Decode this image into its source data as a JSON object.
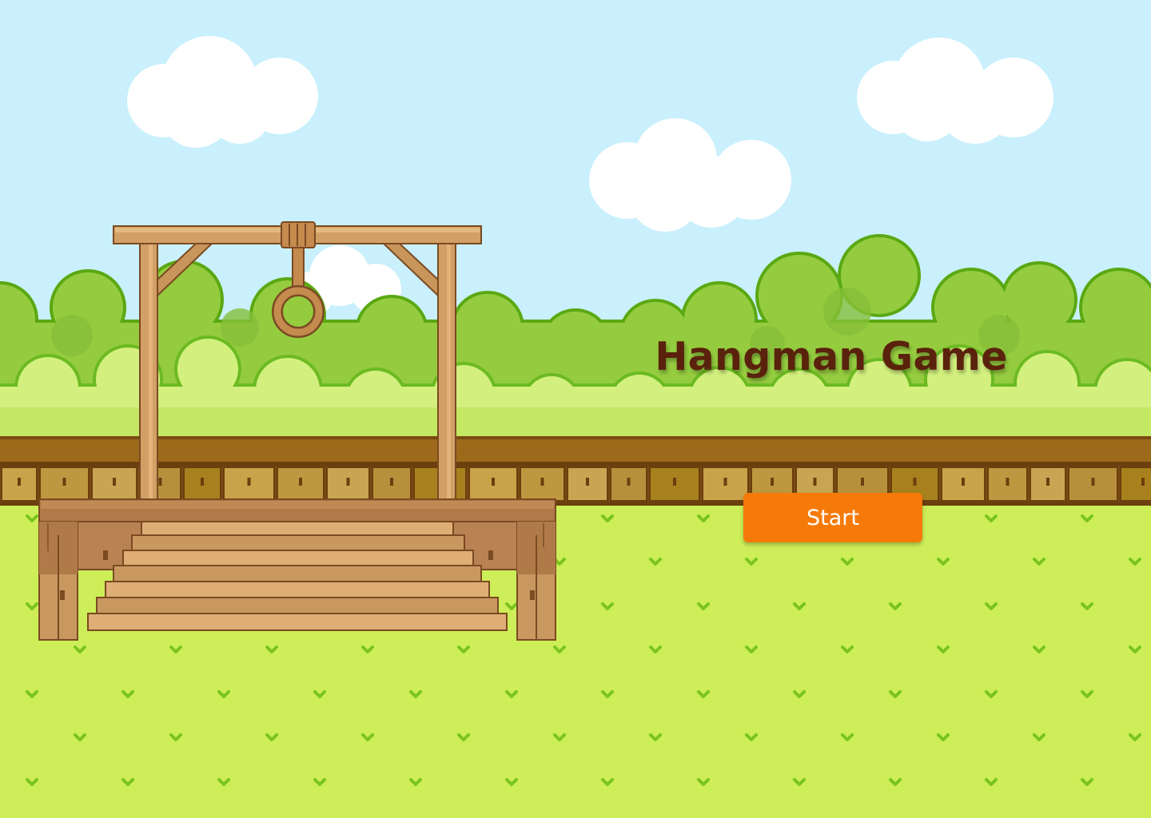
{
  "game": {
    "title": "Hangman Game",
    "start_label": "Start"
  },
  "colors": {
    "sky": "#c9f0fc",
    "grass": "#cdee58",
    "title_text": "#5a220c",
    "button_bg": "#f67a0a",
    "button_text": "#ffffff",
    "wood": "#d2a066"
  },
  "icons": [
    "cloud",
    "bush",
    "fence",
    "gallows",
    "noose",
    "staircase",
    "grass-tuft"
  ]
}
